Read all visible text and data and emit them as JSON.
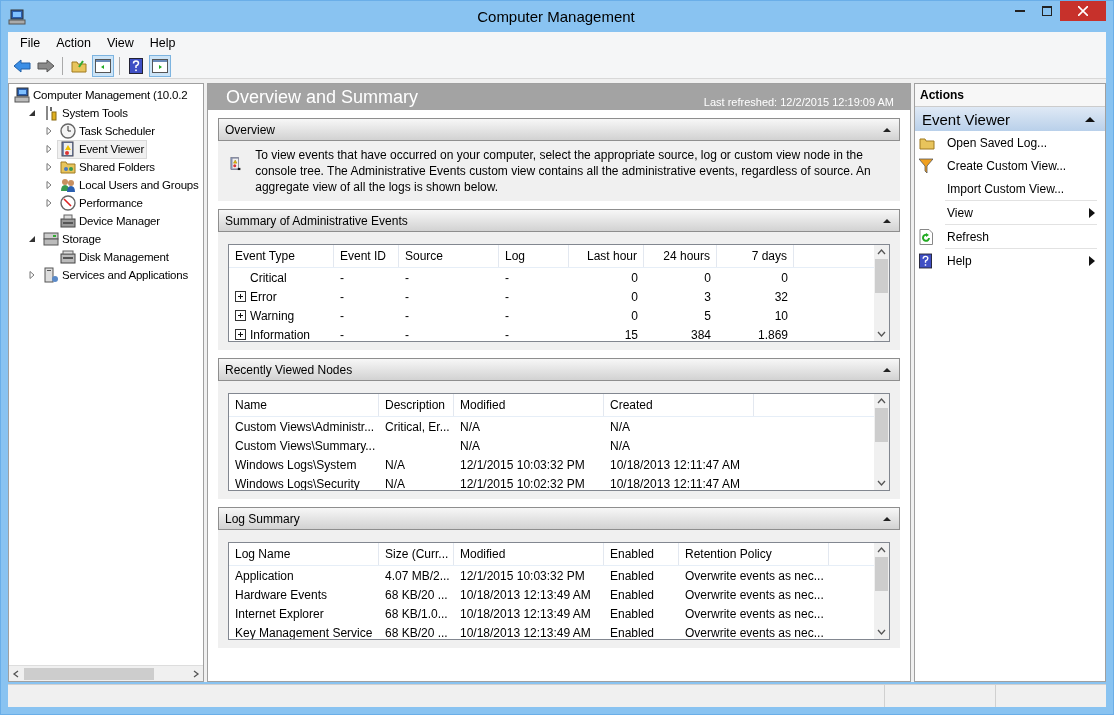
{
  "window": {
    "title": "Computer Management"
  },
  "menu": [
    "File",
    "Action",
    "View",
    "Help"
  ],
  "tree": [
    {
      "label": "Computer Management (10.0.2",
      "selected": false,
      "children": [
        {
          "label": "System Tools",
          "selected": false,
          "expanded": true,
          "children": [
            {
              "label": "Task Scheduler",
              "selected": false,
              "expanded": false
            },
            {
              "label": "Event Viewer",
              "selected": true,
              "expanded": false
            },
            {
              "label": "Shared Folders",
              "selected": false,
              "expanded": false
            },
            {
              "label": "Local Users and Groups",
              "selected": false,
              "expanded": false
            },
            {
              "label": "Performance",
              "selected": false,
              "expanded": false
            },
            {
              "label": "Device Manager",
              "selected": false
            }
          ]
        },
        {
          "label": "Storage",
          "selected": false,
          "expanded": true,
          "children": [
            {
              "label": "Disk Management",
              "selected": false
            }
          ]
        },
        {
          "label": "Services and Applications",
          "selected": false,
          "expanded": false
        }
      ]
    }
  ],
  "content": {
    "title": "Overview and Summary",
    "last_refreshed": "Last refreshed: 12/2/2015 12:19:09 AM",
    "overview": {
      "title": "Overview",
      "expanded": true,
      "text": "To view events that have occurred on your computer, select the appropriate source, log or custom view node in the console tree. The Administrative Events custom view contains all the administrative events, regardless of source. An aggregate view of all the logs is shown below."
    },
    "sections": [
      {
        "title": "Summary of Administrative Events",
        "expanded": true,
        "columns": [
          "Event Type",
          "Event ID",
          "Source",
          "Log",
          "Last hour",
          "24 hours",
          "7 days"
        ],
        "rows": [
          {
            "expandable": false,
            "cells": [
              "Critical",
              "-",
              "-",
              "-",
              "0",
              "0",
              "0"
            ]
          },
          {
            "expandable": true,
            "cells": [
              "Error",
              "-",
              "-",
              "-",
              "0",
              "3",
              "32"
            ]
          },
          {
            "expandable": true,
            "cells": [
              "Warning",
              "-",
              "-",
              "-",
              "0",
              "5",
              "10"
            ]
          },
          {
            "expandable": true,
            "cells": [
              "Information",
              "-",
              "-",
              "-",
              "15",
              "384",
              "1.869"
            ]
          }
        ]
      },
      {
        "title": "Recently Viewed Nodes",
        "expanded": true,
        "columns": [
          "Name",
          "Description",
          "Modified",
          "Created"
        ],
        "rows": [
          {
            "cells": [
              "Custom Views\\Administr...",
              "Critical, Er...",
              "N/A",
              "N/A"
            ]
          },
          {
            "cells": [
              "Custom Views\\Summary...",
              "",
              "N/A",
              "N/A"
            ]
          },
          {
            "cells": [
              "Windows Logs\\System",
              "N/A",
              "12/1/2015 10:03:32 PM",
              "10/18/2013 12:11:47 AM"
            ]
          },
          {
            "cells": [
              "Windows Logs\\Security",
              "N/A",
              "12/1/2015 10:02:32 PM",
              "10/18/2013 12:11:47 AM"
            ]
          }
        ]
      },
      {
        "title": "Log Summary",
        "expanded": true,
        "columns": [
          "Log Name",
          "Size (Curr...",
          "Modified",
          "Enabled",
          "Retention Policy"
        ],
        "rows": [
          {
            "cells": [
              "Application",
              "4.07 MB/2...",
              "12/1/2015 10:03:32 PM",
              "Enabled",
              "Overwrite events as nec..."
            ]
          },
          {
            "cells": [
              "Hardware Events",
              "68 KB/20 ...",
              "10/18/2013 12:13:49 AM",
              "Enabled",
              "Overwrite events as nec..."
            ]
          },
          {
            "cells": [
              "Internet Explorer",
              "68 KB/1.0...",
              "10/18/2013 12:13:49 AM",
              "Enabled",
              "Overwrite events as nec..."
            ]
          },
          {
            "cells": [
              "Key Management Service",
              "68 KB/20 ...",
              "10/18/2013 12:13:49 AM",
              "Enabled",
              "Overwrite events as nec..."
            ]
          }
        ]
      }
    ]
  },
  "actions": {
    "title": "Actions",
    "group": {
      "title": "Event Viewer",
      "expanded": true
    },
    "items": [
      {
        "label": "Open Saved Log...",
        "kind": "item",
        "divider_above": false
      },
      {
        "label": "Create Custom View...",
        "kind": "item",
        "divider_above": false
      },
      {
        "label": "Import Custom View...",
        "kind": "item",
        "divider_above": false
      },
      {
        "label": "View",
        "kind": "submenu",
        "divider_above": true
      },
      {
        "label": "Refresh",
        "kind": "item",
        "divider_above": true
      },
      {
        "label": "Help",
        "kind": "submenu",
        "divider_above": true
      }
    ]
  }
}
